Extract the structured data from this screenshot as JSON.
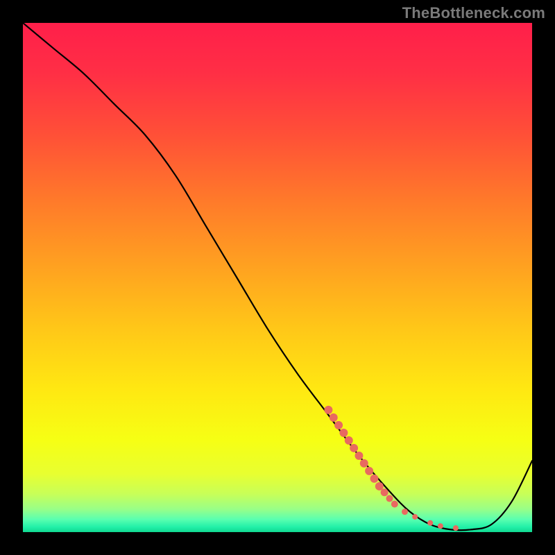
{
  "watermark": "TheBottleneck.com",
  "colors": {
    "curve": "#000000",
    "dot": "#e86a60"
  },
  "gradient_stops": [
    {
      "offset": 0.0,
      "color": "#ff1f4a"
    },
    {
      "offset": 0.1,
      "color": "#ff2f45"
    },
    {
      "offset": 0.22,
      "color": "#ff5037"
    },
    {
      "offset": 0.35,
      "color": "#ff7a2a"
    },
    {
      "offset": 0.48,
      "color": "#ffa220"
    },
    {
      "offset": 0.6,
      "color": "#ffc718"
    },
    {
      "offset": 0.72,
      "color": "#ffe812"
    },
    {
      "offset": 0.82,
      "color": "#f6ff14"
    },
    {
      "offset": 0.885,
      "color": "#e8ff30"
    },
    {
      "offset": 0.925,
      "color": "#c8ff58"
    },
    {
      "offset": 0.955,
      "color": "#98ff88"
    },
    {
      "offset": 0.975,
      "color": "#5affb0"
    },
    {
      "offset": 0.99,
      "color": "#22f0a8"
    },
    {
      "offset": 1.0,
      "color": "#10d890"
    }
  ],
  "chart_data": {
    "type": "line",
    "title": "",
    "xlabel": "",
    "ylabel": "",
    "xlim": [
      0,
      100
    ],
    "ylim": [
      0,
      100
    ],
    "series": [
      {
        "name": "curve",
        "x": [
          0,
          6,
          12,
          18,
          24,
          30,
          36,
          42,
          48,
          54,
          60,
          66,
          72,
          76,
          80,
          84,
          88,
          92,
          96,
          100
        ],
        "y": [
          100,
          95,
          90,
          84,
          78,
          70,
          60,
          50,
          40,
          31,
          23,
          15,
          8,
          4,
          1.5,
          0.5,
          0.5,
          1.5,
          6,
          14
        ]
      }
    ],
    "highlight_points": {
      "name": "cluster",
      "x": [
        60,
        61,
        62,
        63,
        64,
        65,
        66,
        67,
        68,
        69,
        70,
        71,
        72,
        73,
        75,
        77,
        80,
        82,
        85
      ],
      "y": [
        24,
        22.5,
        21,
        19.5,
        18,
        16.5,
        15,
        13.5,
        12,
        10.5,
        9,
        7.8,
        6.6,
        5.5,
        4,
        3,
        1.8,
        1.2,
        0.8
      ],
      "size_hint": [
        6,
        6,
        6,
        6,
        6,
        6,
        6,
        6,
        6,
        6,
        6,
        5.5,
        5,
        5,
        4.5,
        4,
        4,
        4,
        4
      ]
    }
  }
}
